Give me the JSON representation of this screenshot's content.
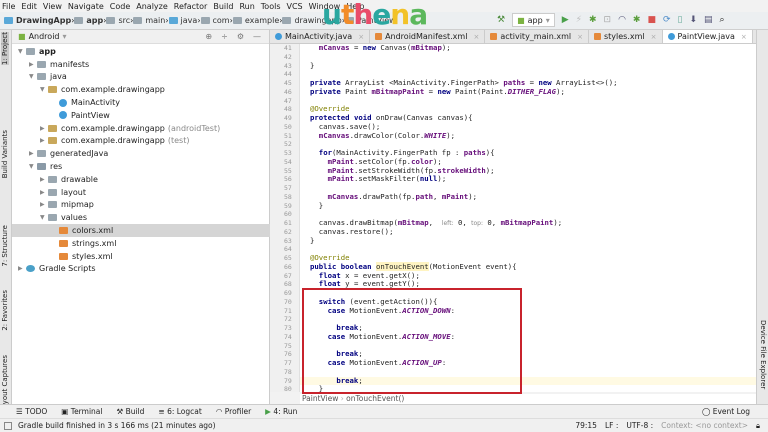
{
  "menu": [
    "File",
    "Edit",
    "View",
    "Navigate",
    "Code",
    "Analyze",
    "Refactor",
    "Build",
    "Run",
    "Tools",
    "VCS",
    "Window",
    "Help"
  ],
  "breadcrumb": [
    "DrawingApp",
    "app",
    "src",
    "main",
    "java",
    "com",
    "example",
    "drawingapp",
    "PaintView"
  ],
  "logo": {
    "text": "uthena",
    "colors": [
      "#2aa7a0",
      "#f28c28",
      "#e94b6a",
      "#2aa7a0",
      "#f2c228",
      "#5cb85c"
    ]
  },
  "toolbar": {
    "run_config": "app"
  },
  "project": {
    "view": "Android",
    "tree": [
      {
        "label": "app",
        "depth": 0,
        "icon": "folder",
        "expanded": true
      },
      {
        "label": "manifests",
        "depth": 1,
        "icon": "folder",
        "expanded": false
      },
      {
        "label": "java",
        "depth": 1,
        "icon": "folder",
        "expanded": true
      },
      {
        "label": "com.example.drawingapp",
        "depth": 2,
        "icon": "package",
        "expanded": true
      },
      {
        "label": "MainActivity",
        "depth": 3,
        "icon": "class"
      },
      {
        "label": "PaintView",
        "depth": 3,
        "icon": "class"
      },
      {
        "label": "com.example.drawingapp",
        "suffix": "(androidTest)",
        "depth": 2,
        "icon": "package",
        "expanded": false
      },
      {
        "label": "com.example.drawingapp",
        "suffix": "(test)",
        "depth": 2,
        "icon": "package",
        "expanded": false
      },
      {
        "label": "generatedJava",
        "depth": 1,
        "icon": "folder",
        "expanded": false
      },
      {
        "label": "res",
        "depth": 1,
        "icon": "res",
        "expanded": true
      },
      {
        "label": "drawable",
        "depth": 2,
        "icon": "folder",
        "expanded": false
      },
      {
        "label": "layout",
        "depth": 2,
        "icon": "folder",
        "expanded": false
      },
      {
        "label": "mipmap",
        "depth": 2,
        "icon": "folder",
        "expanded": false
      },
      {
        "label": "values",
        "depth": 2,
        "icon": "folder",
        "expanded": true
      },
      {
        "label": "colors.xml",
        "depth": 3,
        "icon": "xml",
        "selected": true
      },
      {
        "label": "strings.xml",
        "depth": 3,
        "icon": "xml"
      },
      {
        "label": "styles.xml",
        "depth": 3,
        "icon": "xml"
      },
      {
        "label": "Gradle Scripts",
        "depth": 0,
        "icon": "gradle",
        "expanded": false
      }
    ]
  },
  "left_stripe": [
    "1: Project",
    "Build Variants",
    "7: Structure",
    "2: Favorites",
    "Layout Captures"
  ],
  "right_stripe": [
    "Device File Explorer"
  ],
  "tabs": [
    {
      "label": "MainActivity.java",
      "icon": "class"
    },
    {
      "label": "AndroidManifest.xml",
      "icon": "xml"
    },
    {
      "label": "activity_main.xml",
      "icon": "xml"
    },
    {
      "label": "styles.xml",
      "icon": "xml"
    },
    {
      "label": "PaintView.java",
      "icon": "class",
      "active": true
    }
  ],
  "code": {
    "first_line": 41,
    "current_line": 79,
    "lines": [
      [
        [
          "  "
        ],
        [
          "mCanvas",
          "f"
        ],
        [
          " = "
        ],
        [
          "new",
          "k"
        ],
        [
          " Canvas("
        ],
        [
          "mBitmap",
          "f"
        ],
        [
          ");"
        ]
      ],
      [],
      [
        [
          "}"
        ]
      ],
      [],
      [
        [
          "private",
          "k"
        ],
        [
          " ArrayList <MainActivity.FingerPath> "
        ],
        [
          "paths",
          "f"
        ],
        [
          " = "
        ],
        [
          "new",
          "k"
        ],
        [
          " ArrayList<>();"
        ]
      ],
      [
        [
          "private",
          "k"
        ],
        [
          " Paint "
        ],
        [
          "mBitmapPaint",
          "f"
        ],
        [
          " = "
        ],
        [
          "new",
          "k"
        ],
        [
          " Paint(Paint."
        ],
        [
          "DITHER_FLAG",
          "s"
        ],
        [
          ");"
        ]
      ],
      [],
      [
        [
          "@Override",
          "a"
        ]
      ],
      [
        [
          "protected",
          "k"
        ],
        [
          " "
        ],
        [
          "void",
          "k"
        ],
        [
          " onDraw(Canvas canvas){"
        ]
      ],
      [
        [
          "  canvas.save();"
        ]
      ],
      [
        [
          "  "
        ],
        [
          "mCanvas",
          "f"
        ],
        [
          ".drawColor(Color."
        ],
        [
          "WHITE",
          "s"
        ],
        [
          ");"
        ]
      ],
      [],
      [
        [
          "  "
        ],
        [
          "for",
          "k"
        ],
        [
          "(MainActivity.FingerPath fp : "
        ],
        [
          "paths",
          "f"
        ],
        [
          "){"
        ]
      ],
      [
        [
          "    "
        ],
        [
          "mPaint",
          "f"
        ],
        [
          ".setColor(fp."
        ],
        [
          "color",
          "f"
        ],
        [
          ");"
        ]
      ],
      [
        [
          "    "
        ],
        [
          "mPaint",
          "f"
        ],
        [
          ".setStrokeWidth(fp."
        ],
        [
          "strokeWidth",
          "f"
        ],
        [
          ");"
        ]
      ],
      [
        [
          "    "
        ],
        [
          "mPaint",
          "f"
        ],
        [
          ".setMaskFilter("
        ],
        [
          "null",
          "k"
        ],
        [
          ");"
        ]
      ],
      [],
      [
        [
          "    "
        ],
        [
          "mCanvas",
          "f"
        ],
        [
          ".drawPath(fp."
        ],
        [
          "path",
          "f"
        ],
        [
          ", "
        ],
        [
          "mPaint",
          "f"
        ],
        [
          ");"
        ]
      ],
      [
        [
          "  }"
        ]
      ],
      [],
      [
        [
          "  canvas.drawBitmap("
        ],
        [
          "mBitmap",
          "f"
        ],
        [
          ",  "
        ],
        [
          "left:",
          "h"
        ],
        [
          " 0, "
        ],
        [
          "top:",
          "h"
        ],
        [
          " 0, "
        ],
        [
          "mBitmapPaint",
          "f"
        ],
        [
          ");"
        ]
      ],
      [
        [
          "  canvas.restore();"
        ]
      ],
      [
        [
          "}"
        ]
      ],
      [],
      [
        [
          "@Override",
          "a"
        ]
      ],
      [
        [
          "public",
          "k"
        ],
        [
          " "
        ],
        [
          "boolean",
          "k"
        ],
        [
          " "
        ],
        [
          "onTouchEvent",
          "m"
        ],
        [
          "(MotionEvent event){"
        ]
      ],
      [
        [
          "  "
        ],
        [
          "float",
          "k"
        ],
        [
          " x = event.getX();"
        ]
      ],
      [
        [
          "  "
        ],
        [
          "float",
          "k"
        ],
        [
          " y = event.getY();"
        ]
      ],
      [],
      [
        [
          "  "
        ],
        [
          "switch",
          "k"
        ],
        [
          " (event.getAction()){"
        ]
      ],
      [
        [
          "    "
        ],
        [
          "case",
          "k"
        ],
        [
          " MotionEvent."
        ],
        [
          "ACTION_DOWN",
          "s"
        ],
        [
          ":"
        ]
      ],
      [],
      [
        [
          "      "
        ],
        [
          "break",
          "k"
        ],
        [
          ";"
        ]
      ],
      [
        [
          "    "
        ],
        [
          "case",
          "k"
        ],
        [
          " MotionEvent."
        ],
        [
          "ACTION_MOVE",
          "s"
        ],
        [
          ":"
        ]
      ],
      [],
      [
        [
          "      "
        ],
        [
          "break",
          "k"
        ],
        [
          ";"
        ]
      ],
      [
        [
          "    "
        ],
        [
          "case",
          "k"
        ],
        [
          " MotionEvent."
        ],
        [
          "ACTION_UP",
          "s"
        ],
        [
          ":"
        ]
      ],
      [],
      [
        [
          "      "
        ],
        [
          "break",
          "k"
        ],
        [
          ";"
        ]
      ],
      [
        [
          "  }"
        ]
      ]
    ]
  },
  "editor_breadcrumb": [
    "PaintView",
    "onTouchEvent()"
  ],
  "bottom_tools": [
    "TODO",
    "Terminal",
    "Build",
    "6: Logcat",
    "Profiler",
    "4: Run"
  ],
  "event_log": "Event Log",
  "status": {
    "message": "Gradle build finished in 3 s 166 ms (21 minutes ago)",
    "position": "79:15",
    "line_sep": "LF :",
    "encoding": "UTF-8 :",
    "context": "Context: <no context>"
  },
  "highlight_color": "#c8232c"
}
